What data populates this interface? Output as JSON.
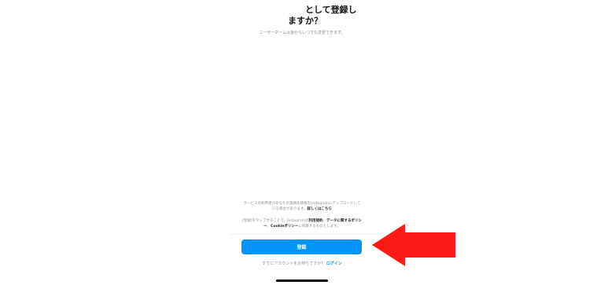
{
  "header": {
    "title_line1": "として登録し",
    "title_line2": "ますか？",
    "subtitle": "ユーザーネームは後からいつでも変更できます。"
  },
  "info": {
    "text": "サービスの利用者があなたの連絡先情報をInstagramにアップロードしている場合があります。",
    "link": "詳しくはこちら"
  },
  "terms": {
    "prefix": "[登録]をタップすることで、Instagramの",
    "terms_link": "利用規約",
    "separator": "、",
    "data_policy_link": "データに関するポリシー",
    "separator2": "、",
    "cookie_policy_link": "Cookieポリシー",
    "suffix": "に同意するものとします。"
  },
  "actions": {
    "register_label": "登録"
  },
  "footer": {
    "question": "すでにアカウントをお持ちですか？",
    "login_label": "ログイン"
  },
  "annotation": {
    "arrow_color": "#ff1a1a"
  },
  "colors": {
    "primary": "#0095f6",
    "text_muted": "#8e8e8e"
  }
}
